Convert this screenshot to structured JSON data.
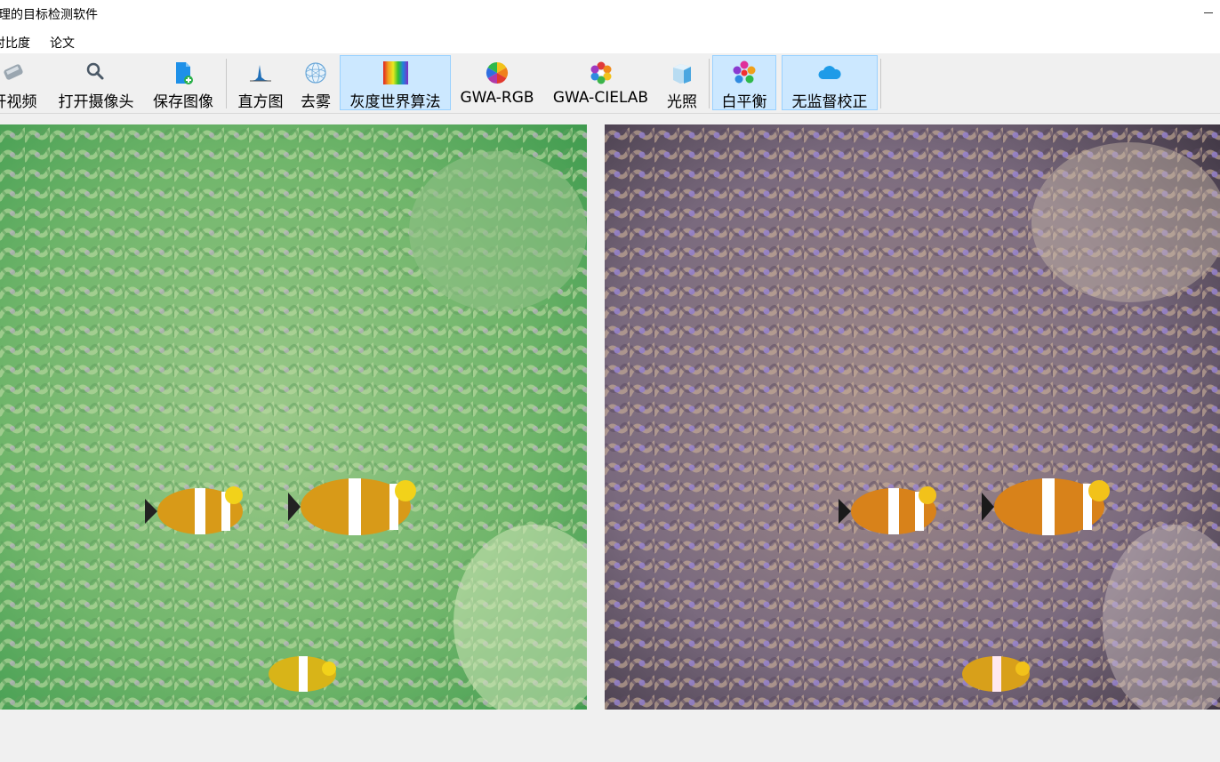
{
  "window": {
    "title": "处理的目标检测软件"
  },
  "menu": {
    "items": [
      "对比度",
      "论文"
    ]
  },
  "toolbar": {
    "open_video": "开视频",
    "open_camera": "打开摄像头",
    "save_image": "保存图像",
    "histogram": "直方图",
    "dehaze": "去雾",
    "gray_world": "灰度世界算法",
    "gwa_rgb": "GWA-RGB",
    "gwa_cielab": "GWA-CIELAB",
    "illumination": "光照",
    "white_balance": "白平衡",
    "unsupervised": "无监督校正"
  },
  "colors": {
    "active_bg": "#cce8ff",
    "active_border": "#99d1ff",
    "original_tint": "#6fb56a",
    "corrected_tint": "#7a6a7e"
  },
  "icons": {
    "open_video": "video-icon",
    "open_camera": "magnifier-icon",
    "save_image": "save-file-icon",
    "histogram": "histogram-icon",
    "dehaze": "sphere-icon",
    "gray_world": "rainbow-icon",
    "gwa_rgb": "color-wheel-icon",
    "gwa_cielab": "flower-icon",
    "illumination": "cube-icon",
    "white_balance": "color-dots-icon",
    "unsupervised": "cloud-icon"
  }
}
